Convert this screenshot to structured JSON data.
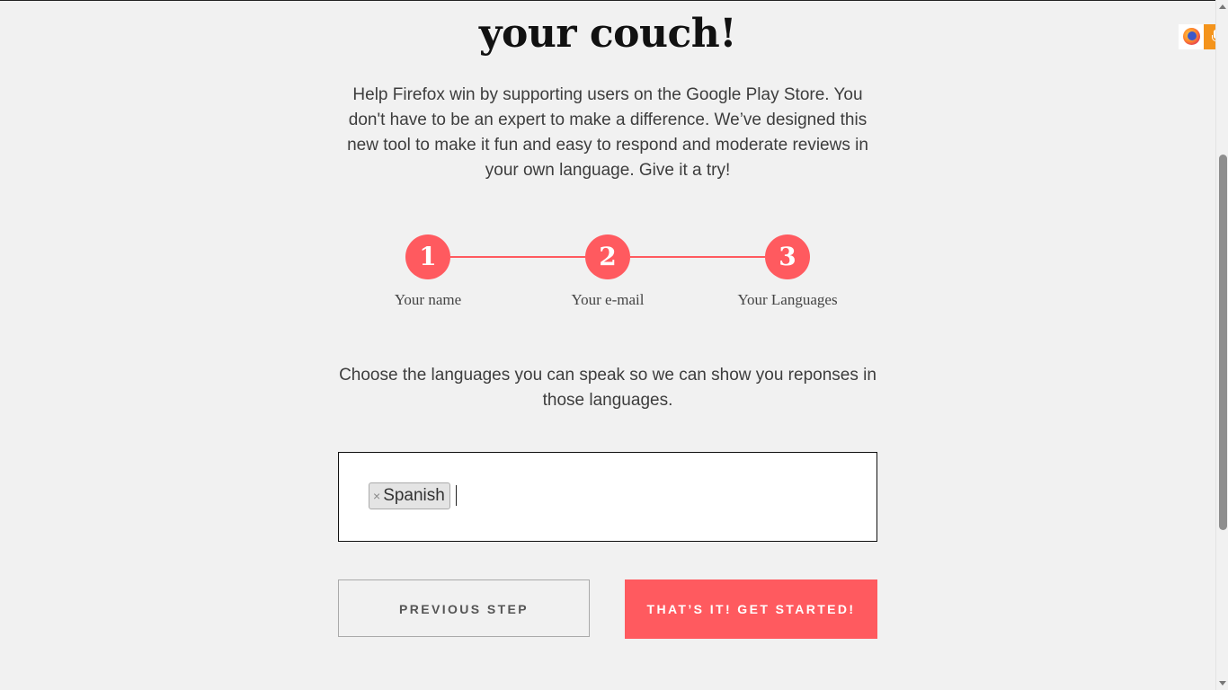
{
  "hero": {
    "title": "your couch!",
    "intro": "Help Firefox win by supporting users on the Google Play Store. You don't have to be an expert to make a difference. We’ve designed this new tool to make it fun and easy to respond and moderate reviews in your own language. Give it a try!"
  },
  "stepper": {
    "steps": [
      {
        "number": "1",
        "label": "Your name"
      },
      {
        "number": "2",
        "label": "Your e-mail"
      },
      {
        "number": "3",
        "label": "Your Languages"
      }
    ],
    "color": "#ff5a5f"
  },
  "languages": {
    "prompt": "Choose the languages you can speak so we can show you reponses in those languages.",
    "selected": [
      {
        "remove_glyph": "×",
        "label": "Spanish"
      }
    ]
  },
  "buttons": {
    "previous": "PREVIOUS STEP",
    "start": "THAT’S IT! GET STARTED!"
  },
  "extensions": {
    "icons": [
      "firefox-icon",
      "microphone-icon"
    ],
    "mic_color": "#f4941c"
  }
}
